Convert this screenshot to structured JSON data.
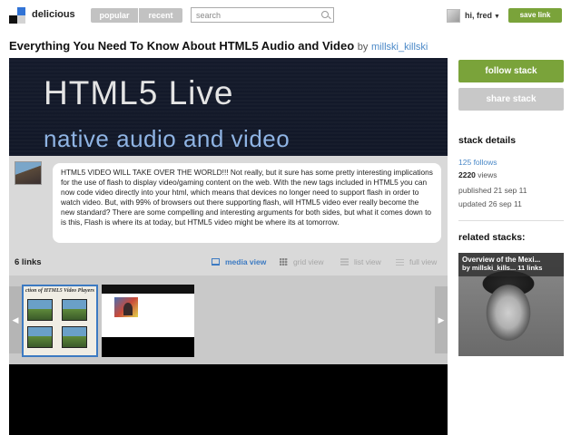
{
  "header": {
    "brand": "delicious",
    "tabs": [
      {
        "label": "popular"
      },
      {
        "label": "recent"
      }
    ],
    "search_placeholder": "search",
    "user_greeting": "hi, fred",
    "save_link_label": "save link"
  },
  "stack": {
    "title": "Everything You Need To Know About HTML5 Audio and Video",
    "by_label": "by",
    "author": "millski_killski",
    "hero_line1": "HTML5 Live",
    "hero_line2": "native audio and video",
    "description": "HTML5 VIDEO WILL TAKE OVER THE WORLD!!! Not really, but it sure has some pretty interesting implications for the use of flash to display video/gaming content on the web. With the new tags included in HTML5 you can now code video directly into your html, which means that devices no longer need to support flash in order to watch video.  But, with 99% of browsers out there supporting flash, will HTML5 video ever really become the new standard? There are some compelling and interesting arguments for both sides, but what it comes down to is this, Flash is where its at today, but HTML5 video might be where its at tomorrow.",
    "links_count": "6 links",
    "views": [
      {
        "label": "media view",
        "icon": "monitor-icon",
        "active": true
      },
      {
        "label": "grid view",
        "icon": "grid-icon",
        "active": false
      },
      {
        "label": "list view",
        "icon": "list-icon",
        "active": false
      },
      {
        "label": "full view",
        "icon": "full-list-icon",
        "active": false
      }
    ],
    "thumb1_title": "ction of HTML5 Video Players"
  },
  "sidebar": {
    "follow_label": "follow stack",
    "share_label": "share stack",
    "details_heading": "stack details",
    "follows_num": "125",
    "follows_label": "follows",
    "views_num": "2220",
    "views_label": "views",
    "published": "published 21 sep 11",
    "updated": "updated 26 sep 11",
    "related_heading": "related stacks:",
    "related": {
      "title": "Overview of the Mexi...",
      "meta": "by millski_kills... 11 links"
    }
  },
  "colors": {
    "accent_green": "#7aa33a",
    "link_blue": "#4a88c7",
    "active_view_blue": "#3c7ac2"
  }
}
